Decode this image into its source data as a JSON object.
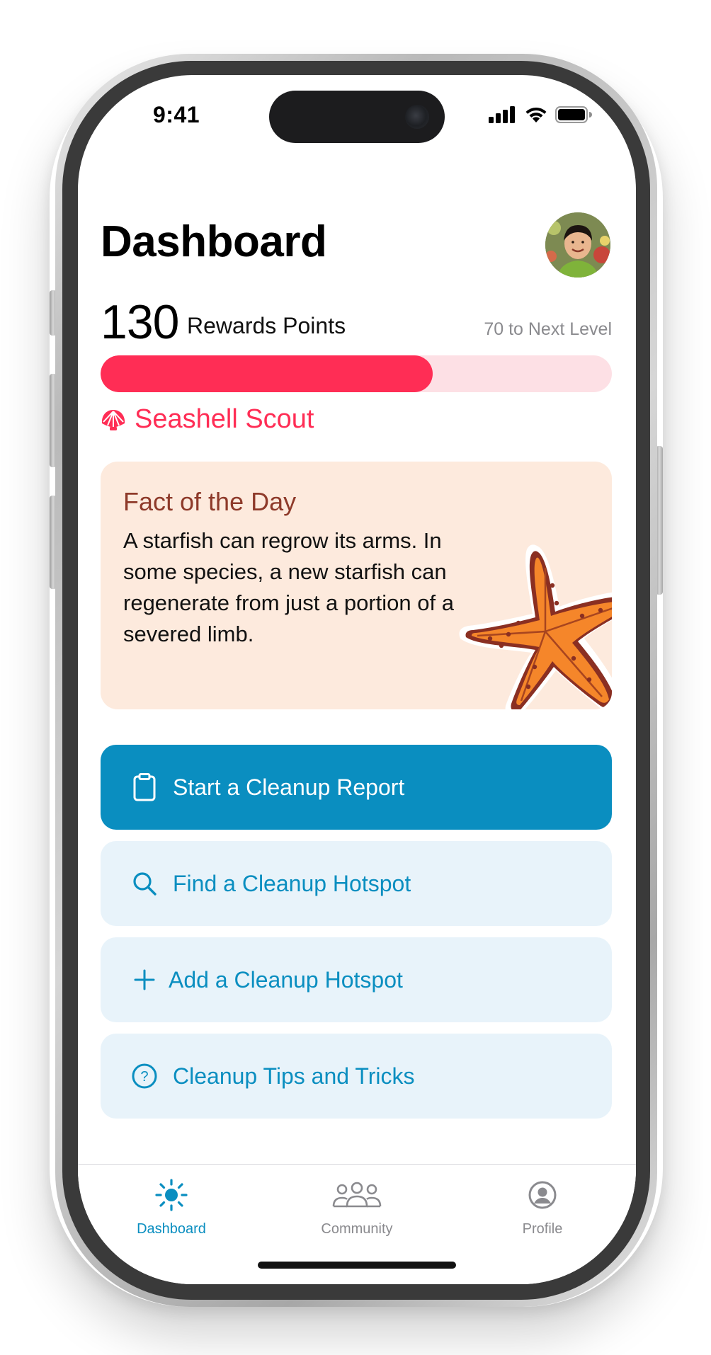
{
  "status_bar": {
    "time": "9:41"
  },
  "header": {
    "title": "Dashboard"
  },
  "rewards": {
    "points": "130",
    "points_label": "Rewards Points",
    "next_level": "70 to Next Level",
    "progress_fraction": 0.65,
    "rank": "Seashell Scout"
  },
  "fact": {
    "title": "Fact of the Day",
    "body": "A starfish can regrow its arms. In some species, a new starfish can regenerate from just a portion of a severed limb."
  },
  "actions": [
    {
      "label": "Start a Cleanup Report",
      "icon": "clipboard-icon",
      "style": "primary"
    },
    {
      "label": "Find a Cleanup Hotspot",
      "icon": "search-icon",
      "style": "secondary"
    },
    {
      "label": "Add a Cleanup Hotspot",
      "icon": "plus-icon",
      "style": "secondary"
    },
    {
      "label": "Cleanup Tips and Tricks",
      "icon": "question-circle-icon",
      "style": "secondary"
    }
  ],
  "tabs": [
    {
      "label": "Dashboard",
      "icon": "sun-icon",
      "active": true
    },
    {
      "label": "Community",
      "icon": "people-icon",
      "active": false
    },
    {
      "label": "Profile",
      "icon": "person-circle-icon",
      "active": false
    }
  ],
  "colors": {
    "accent": "#0a8ec0",
    "rewards": "#ff2d55",
    "rewards_track": "#fde0e5",
    "fact_bg": "#fdeadd",
    "fact_title": "#8e3a2a",
    "secondary_button_bg": "#e8f3fa"
  }
}
